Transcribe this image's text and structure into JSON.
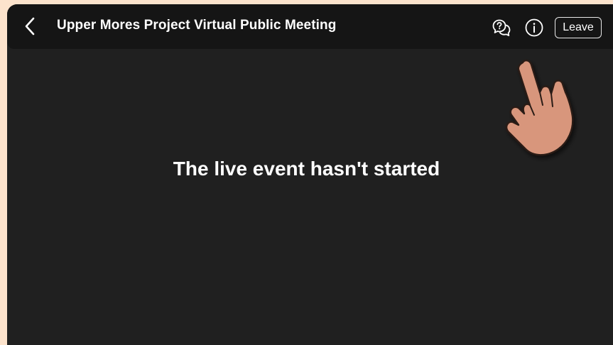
{
  "header": {
    "back_icon": "chevron-left-icon",
    "title": "Upper Mores Project Virtual Public Meeting",
    "help_icon": "help-chat-icon",
    "info_icon": "info-icon",
    "leave_label": "Leave"
  },
  "main": {
    "status_message": "The live event hasn't started"
  },
  "overlay": {
    "pointer_icon": "hand-pointer-icon"
  },
  "colors": {
    "page_background": "#fce3cc",
    "app_background": "#202020",
    "header_background": "#151515",
    "text": "#ffffff",
    "hand_fill": "#d8967c"
  }
}
